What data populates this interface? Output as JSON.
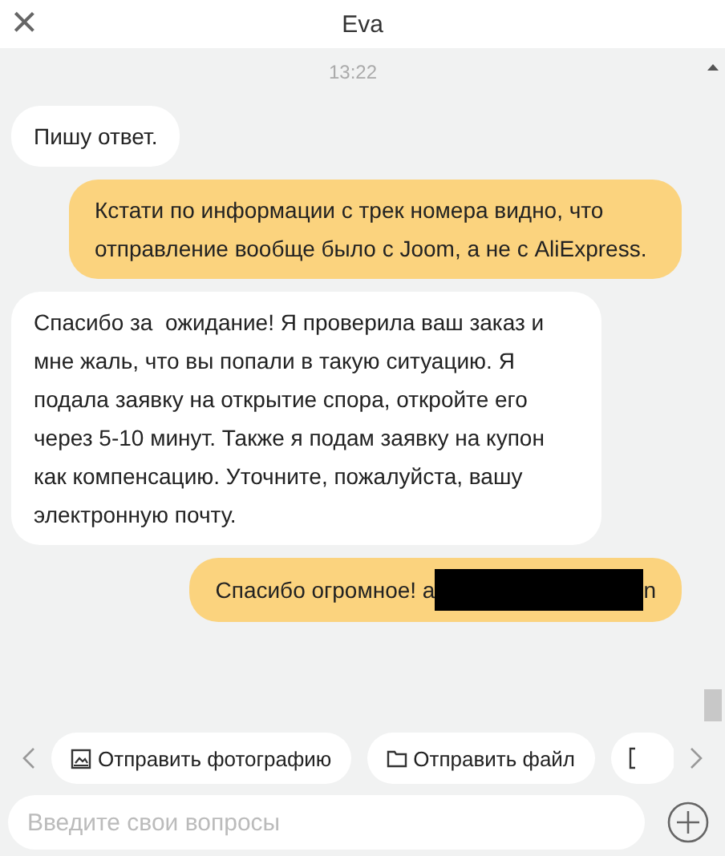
{
  "header": {
    "close_icon": "×",
    "title": "Eva"
  },
  "timestamp": "13:22",
  "messages": [
    {
      "kind": "incoming",
      "text": "Пишу ответ."
    },
    {
      "kind": "outgoing",
      "text": "Кстати по информации с трек номера видно, что отправление вообще было с Joom, а не с AliExpress."
    },
    {
      "kind": "incoming",
      "text": "Спасибо за  ожидание! Я проверила ваш заказ и мне жаль, что вы попали в такую ситуацию. Я подала заявку на открытие спора, откройте его через 5-10 минут. Также я подам заявку на купон как компенсацию. Уточните, пожалуйста, вашу электронную почту."
    },
    {
      "kind": "outgoing",
      "text": "Спасибо огромное! a",
      "redacted": true,
      "text_end": "n"
    }
  ],
  "quick_actions": [
    {
      "kind": "photo",
      "label": "Отправить фотографию"
    },
    {
      "kind": "file",
      "label": "Отправить файл"
    },
    {
      "kind": "partial"
    }
  ],
  "input": {
    "placeholder": "Введите свои вопросы"
  }
}
